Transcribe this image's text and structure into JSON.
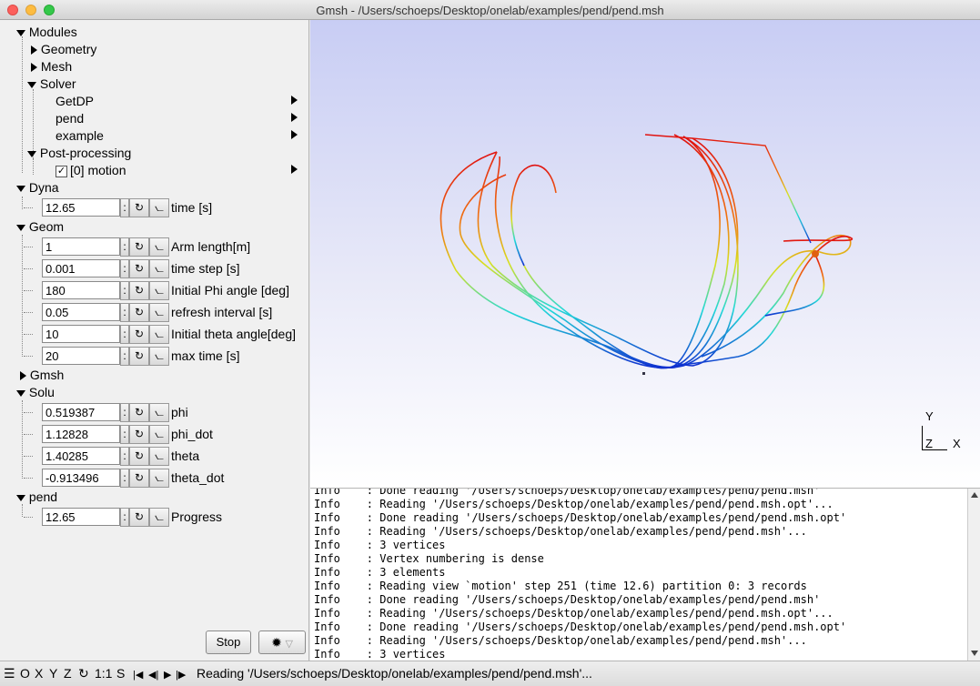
{
  "window": {
    "title": "Gmsh - /Users/schoeps/Desktop/onelab/examples/pend/pend.msh"
  },
  "tree": {
    "modules": "Modules",
    "geometry": "Geometry",
    "mesh": "Mesh",
    "solver": "Solver",
    "getdp": "GetDP",
    "pend_solver": "pend",
    "example": "example",
    "postprocessing": "Post-processing",
    "motion": "[0] motion",
    "motion_checked": "✓",
    "dyna": "Dyna",
    "geom": "Geom",
    "gmsh": "Gmsh",
    "solu": "Solu",
    "pend": "pend"
  },
  "params": {
    "dyna": [
      {
        "value": "12.65",
        "label": "time [s]"
      }
    ],
    "geom": [
      {
        "value": "1",
        "label": "Arm length[m]"
      },
      {
        "value": "0.001",
        "label": "time step [s]"
      },
      {
        "value": "180",
        "label": "Initial Phi angle [deg]"
      },
      {
        "value": "0.05",
        "label": "refresh interval [s]"
      },
      {
        "value": "10",
        "label": "Initial theta angle[deg]"
      },
      {
        "value": "20",
        "label": "max time [s]"
      }
    ],
    "solu": [
      {
        "value": "0.519387",
        "label": "phi"
      },
      {
        "value": "1.12828",
        "label": "phi_dot"
      },
      {
        "value": "1.40285",
        "label": "theta"
      },
      {
        "value": "-0.913496",
        "label": "theta_dot"
      }
    ],
    "pend": [
      {
        "value": "12.65",
        "label": "Progress"
      }
    ]
  },
  "buttons": {
    "stop": "Stop"
  },
  "axes": {
    "y": "Y",
    "z": "Z",
    "x": "X"
  },
  "messages": [
    "Info    : Done reading '/Users/schoeps/Desktop/onelab/examples/pend/pend.msh'",
    "Info    : Reading '/Users/schoeps/Desktop/onelab/examples/pend/pend.msh.opt'...",
    "Info    : Done reading '/Users/schoeps/Desktop/onelab/examples/pend/pend.msh.opt'",
    "Info    : Reading '/Users/schoeps/Desktop/onelab/examples/pend/pend.msh'...",
    "Info    : 3 vertices",
    "Info    : Vertex numbering is dense",
    "Info    : 3 elements",
    "Info    : Reading view `motion' step 251 (time 12.6) partition 0: 3 records",
    "Info    : Done reading '/Users/schoeps/Desktop/onelab/examples/pend/pend.msh'",
    "Info    : Reading '/Users/schoeps/Desktop/onelab/examples/pend/pend.msh.opt'...",
    "Info    : Done reading '/Users/schoeps/Desktop/onelab/examples/pend/pend.msh.opt'",
    "Info    : Reading '/Users/schoeps/Desktop/onelab/examples/pend/pend.msh'...",
    "Info    : 3 vertices"
  ],
  "statusbar": {
    "menu_icon": "☰",
    "o": "O",
    "x": "X",
    "y": "Y",
    "z": "Z",
    "rotate": "↻",
    "scale": "1:1",
    "s": "S",
    "message": "Reading '/Users/schoeps/Desktop/onelab/examples/pend/pend.msh'..."
  }
}
